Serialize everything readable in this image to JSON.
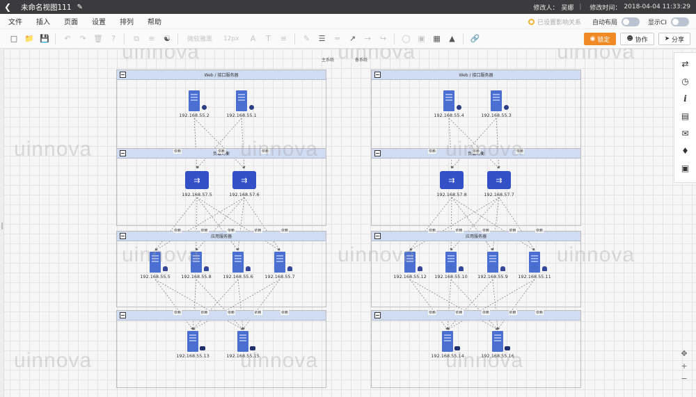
{
  "titlebar": {
    "back_icon": "back-arrow-icon",
    "title": "未命名视图111",
    "edit_icon": "pencil-icon",
    "modifier_label": "修改人：",
    "modifier": "吴娜",
    "time_label": "修改时间：",
    "time": "2018-04-04 11:33:29"
  },
  "menubar": {
    "items": [
      "文件",
      "插入",
      "页面",
      "设置",
      "排列",
      "帮助"
    ],
    "impact_label": "已设置影响关系",
    "auto_layout": "自动布局",
    "show_ci": "显示CI"
  },
  "toolbar": {
    "font_name": "微软雅黑",
    "font_size": "12px",
    "lock_button": "锁定",
    "collab_button": "协作",
    "share_button": "分享"
  },
  "diagram": {
    "primary_label": "主系统",
    "backup_label": "备系统",
    "panel_titles": [
      "Web / 接口服务器",
      "负载均衡",
      "应用服务器",
      ""
    ],
    "edge_label": "依赖",
    "left": {
      "web": [
        "192.168.55.2",
        "192.168.55.1"
      ],
      "lb": [
        "192.168.57.5",
        "192.168.57.6"
      ],
      "app": [
        "192.168.55.5",
        "192.168.55.8",
        "192.168.55.6",
        "192.168.55.7"
      ],
      "db": [
        "192.168.55.13",
        "192.168.55.15"
      ]
    },
    "right": {
      "web": [
        "192.168.55.4",
        "192.168.55.3"
      ],
      "lb": [
        "192.168.57.8",
        "192.168.57.7"
      ],
      "app": [
        "192.168.55.12",
        "192.168.55.10",
        "192.168.55.9",
        "192.168.55.11"
      ],
      "db": [
        "192.168.55.14",
        "192.168.55.16"
      ]
    }
  },
  "watermark": "uinnova",
  "colors": {
    "accent": "#f08a24",
    "server": "#4b6fd0",
    "lb": "#3350c7",
    "panel_header": "#cfdcf1"
  }
}
